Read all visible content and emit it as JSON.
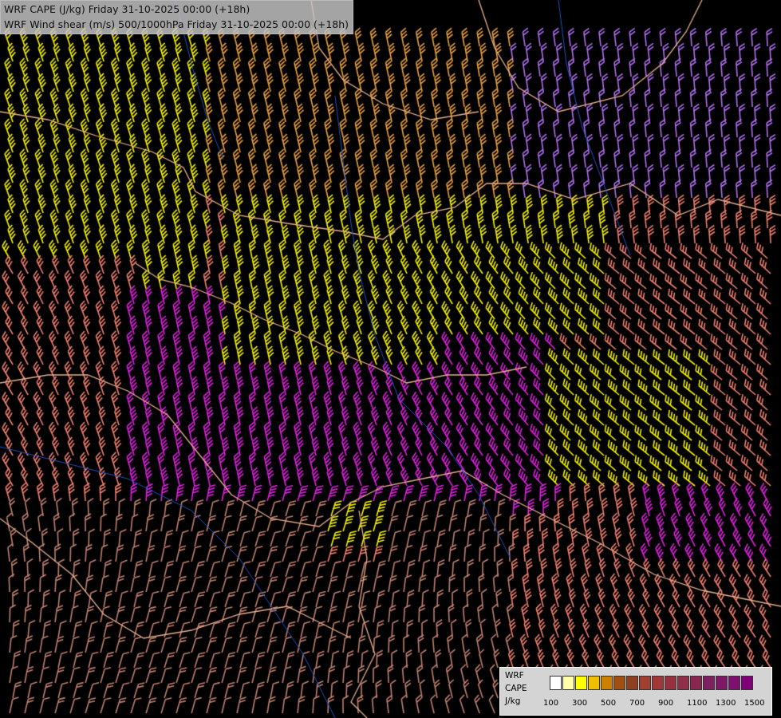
{
  "title": {
    "line1": "WRF CAPE (J/kg) Friday 31-10-2025 00:00 (+18h)",
    "line2": "WRF Wind shear (m/s) 500/1000hPa Friday 31-10-2025 00:00 (+18h)"
  },
  "map": {
    "region": "Central/Eastern Europe",
    "barb_colors": {
      "yellow": "#f5f200",
      "orange": "#e8a040",
      "salmon": "#f08070",
      "magenta": "#e020e0",
      "violet": "#b070f0",
      "brown": "#c08070"
    },
    "border_color": "#e8b090",
    "river_color": "#2050c0"
  },
  "legend": {
    "model_label": "WRF",
    "field_label": "CAPE",
    "unit_label": "J/kg",
    "colors": [
      "#ffffff",
      "#ffffaa",
      "#ffff00",
      "#f0c000",
      "#d08000",
      "#a05010",
      "#904020",
      "#a04030",
      "#a03838",
      "#983040",
      "#903048",
      "#882850",
      "#802060",
      "#801868",
      "#801070",
      "#800078"
    ],
    "tick_labels": [
      "100",
      "300",
      "500",
      "700",
      "900",
      "1100",
      "1300",
      "1500"
    ]
  }
}
